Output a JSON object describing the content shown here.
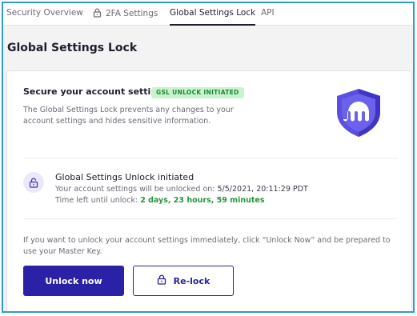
{
  "tabs": [
    {
      "label": "Security Overview"
    },
    {
      "label": "2FA Settings",
      "icon": "lock-icon"
    },
    {
      "label": "Global Settings Lock",
      "active": true
    },
    {
      "label": "API"
    }
  ],
  "page_title": "Global Settings Lock",
  "card": {
    "title": "Secure your account settings",
    "badge": "GSL UNLOCK INITIATED",
    "description": "The Global Settings Lock prevents any changes to your account settings and hides sensitive information.",
    "shield_icon": "kraken-shield-icon"
  },
  "status": {
    "icon": "unlock-icon",
    "title": "Global Settings Unlock initiated",
    "unlock_prefix": "Your account settings will be unlocked on:",
    "unlock_date": "5/5/2021, 20:11:29 PDT",
    "time_left_prefix": "Time left until unlock:",
    "time_left": "2 days, 23 hours, 59 minutes"
  },
  "notice": "If you want to unlock your account settings immediately, click “Unlock Now” and be prepared to use your Master Key.",
  "buttons": {
    "unlock_now": "Unlock now",
    "relock": "Re-lock"
  },
  "colors": {
    "accent": "#2a21a7",
    "badge_bg": "#c9f3cf",
    "badge_text": "#1c8a34",
    "frame_border": "#2f9bd6",
    "shield": "#4b3fd6"
  }
}
